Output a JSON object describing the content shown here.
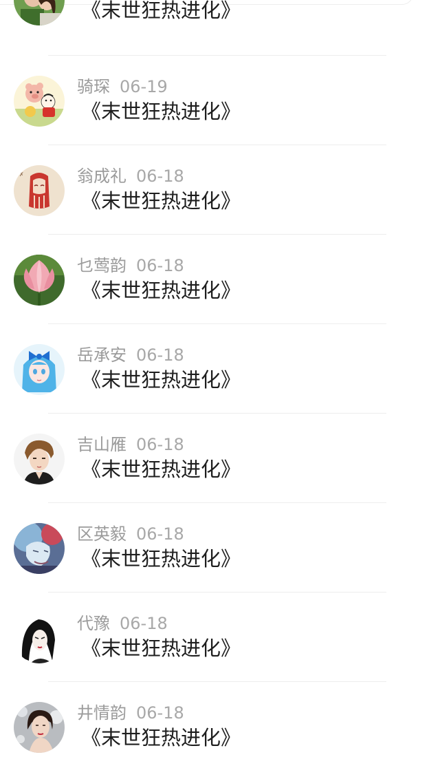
{
  "comments": [
    {
      "username": "",
      "date": "",
      "content": "《末世狂热进化》",
      "avatar_icon": "couple-photo-icon"
    },
    {
      "username": "骑琛",
      "date": "06-19",
      "content": "《末世狂热进化》",
      "avatar_icon": "cartoon-pig-icon"
    },
    {
      "username": "翁成礼",
      "date": "06-18",
      "content": "《末世狂热进化》",
      "avatar_icon": "red-braid-drawing-icon"
    },
    {
      "username": "乜莺韵",
      "date": "06-18",
      "content": "《末世狂热进化》",
      "avatar_icon": "lotus-flower-icon"
    },
    {
      "username": "岳承安",
      "date": "06-18",
      "content": "《末世狂热进化》",
      "avatar_icon": "anime-girl-blue-bow-icon"
    },
    {
      "username": "吉山雁",
      "date": "06-18",
      "content": "《末世狂热进化》",
      "avatar_icon": "anime-boy-icon"
    },
    {
      "username": "区英毅",
      "date": "06-18",
      "content": "《末世狂热进化》",
      "avatar_icon": "ice-face-art-icon"
    },
    {
      "username": "代豫",
      "date": "06-18",
      "content": "《末世狂热进化》",
      "avatar_icon": "ink-woman-portrait-icon"
    },
    {
      "username": "井情韵",
      "date": "06-18",
      "content": "《末世狂热进化》",
      "avatar_icon": "woman-photo-icon"
    }
  ]
}
